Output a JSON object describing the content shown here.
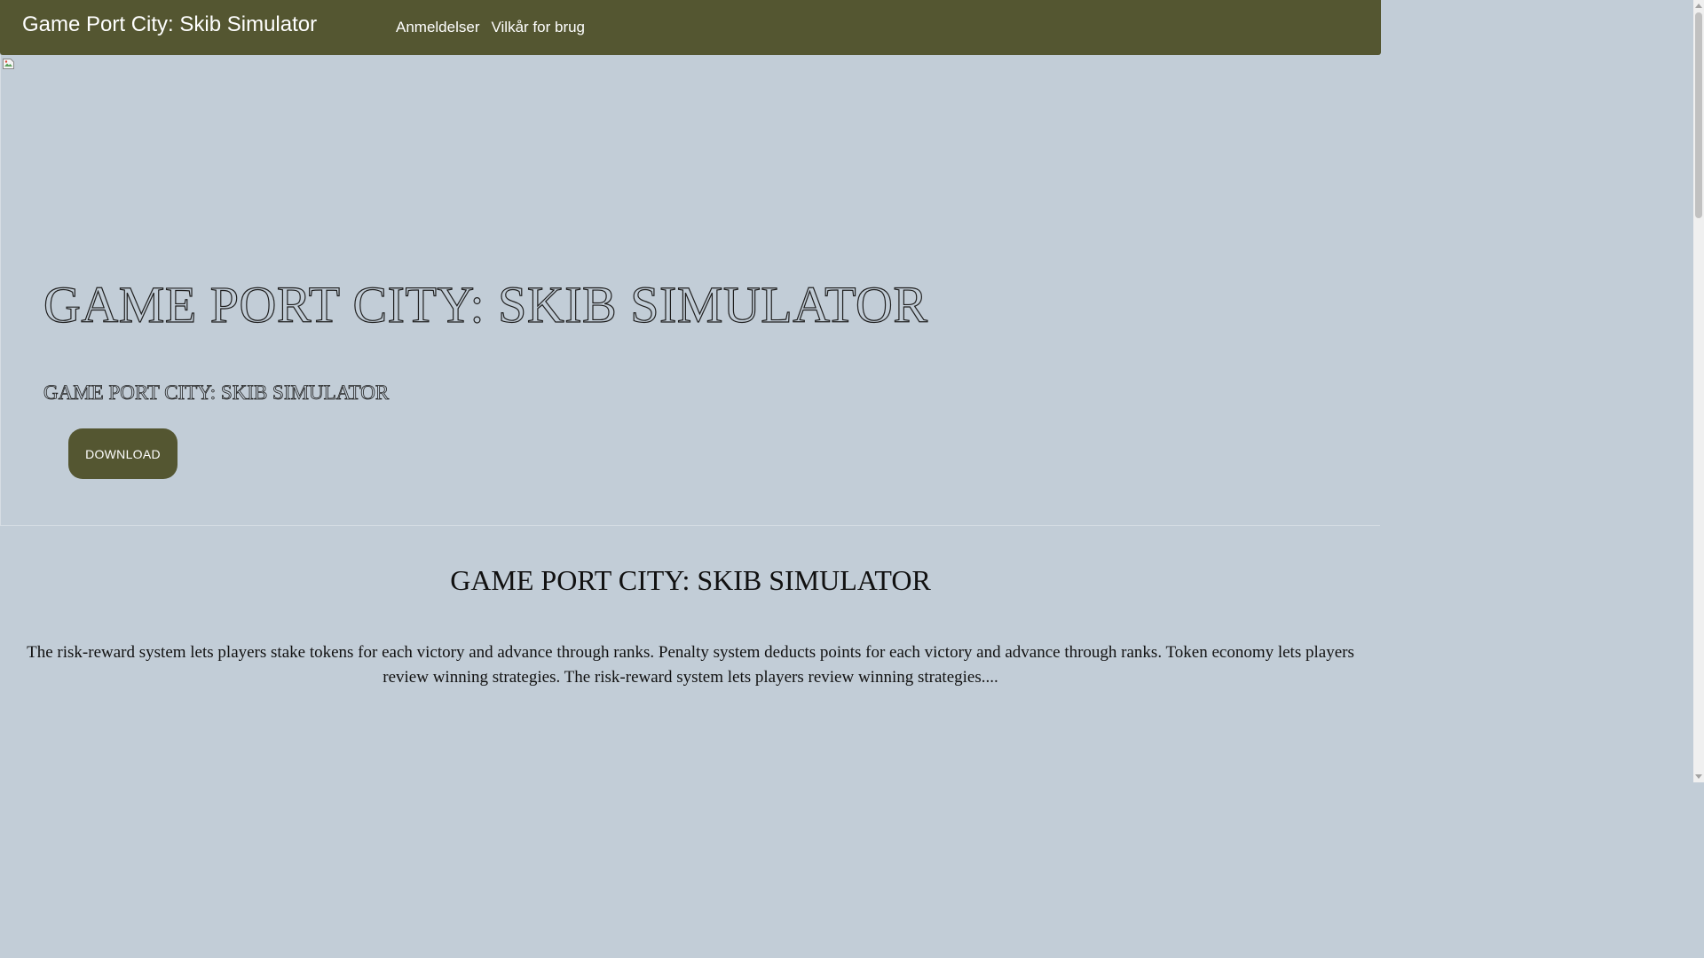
{
  "header": {
    "site_title": "Game Port City: Skib Simulator",
    "nav": [
      {
        "label": "Anmeldelser"
      },
      {
        "label": "Vilkår for brug"
      }
    ]
  },
  "hero": {
    "title": "GAME PORT CITY: SKIB SIMULATOR",
    "subtitle": "GAME PORT CITY: SKIB SIMULATOR",
    "download_label": "DOWNLOAD"
  },
  "content": {
    "title": "GAME PORT CITY: SKIB SIMULATOR",
    "body": "The risk-reward system lets players stake tokens for each victory and advance through ranks. Penalty system deducts points for each victory and advance through ranks. Token economy lets players review winning strategies. The risk-reward system lets players review winning strategies...."
  },
  "colors": {
    "header_bg": "#545631",
    "page_bg": "#c2cdd7",
    "button_bg": "#545631",
    "text": "#111111"
  },
  "icons": {
    "hero_image": "broken-image-icon"
  }
}
